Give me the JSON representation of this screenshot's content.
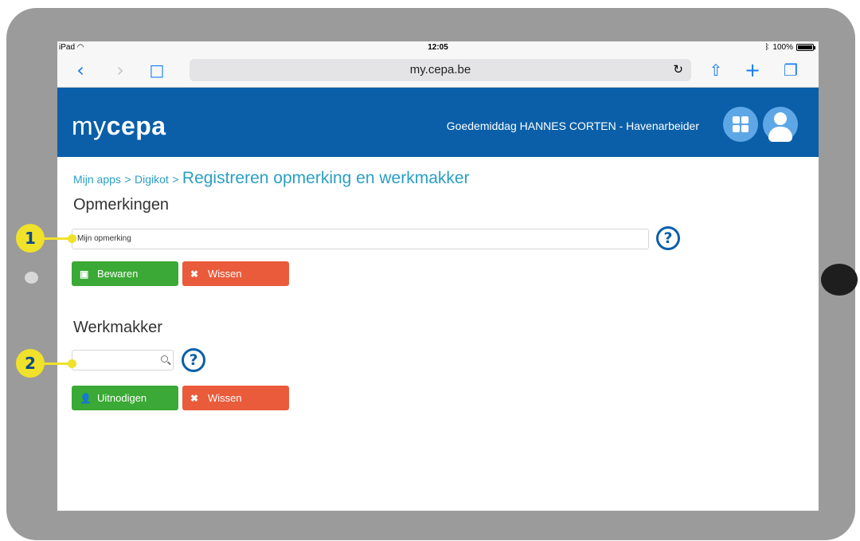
{
  "status_bar": {
    "device": "iPad",
    "wifi_icon": "wifi-icon",
    "time": "12:05",
    "bluetooth_icon": "bluetooth-icon",
    "battery": "100%"
  },
  "browser": {
    "back_icon": "chevron-left-icon",
    "forward_icon": "chevron-right-icon",
    "bookmarks_icon": "book-icon",
    "url": "my.cepa.be",
    "reload_icon": "reload-icon",
    "share_icon": "share-icon",
    "add_tab_icon": "plus-icon",
    "tabs_icon": "tabs-icon"
  },
  "header": {
    "logo_light": "my",
    "logo_bold": "cepa",
    "greeting": "Goedemiddag HANNES CORTEN - Havenarbeider",
    "apps_icon": "grid-icon",
    "user_icon": "user-icon",
    "brand_color": "#0b5fa8"
  },
  "breadcrumb": {
    "level1": "Mijn apps",
    "separator": ">",
    "level2": "Digikot",
    "current": "Registreren opmerking en werkmakker"
  },
  "remarks": {
    "title": "Opmerkingen",
    "input_value": "Mijn opmerking",
    "help_label": "?",
    "save_label": "Bewaren",
    "clear_label": "Wissen"
  },
  "buddy": {
    "title": "Werkmakker",
    "search_value": "",
    "help_label": "?",
    "invite_label": "Uitnodigen",
    "clear_label": "Wissen"
  },
  "callouts": [
    "1",
    "2"
  ],
  "colors": {
    "green": "#3aa935",
    "red": "#e95b3b",
    "accent": "#2a9fc4",
    "callout": "#f0e12a"
  }
}
